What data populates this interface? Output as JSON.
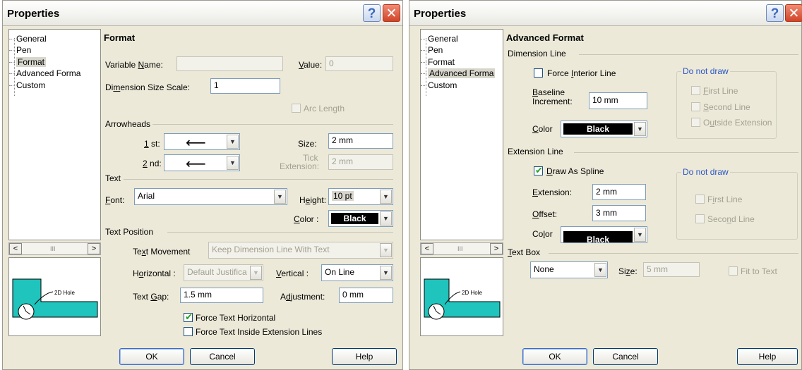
{
  "left": {
    "title": "Properties",
    "tree": [
      "General",
      "Pen",
      "Format",
      "Advanced Forma",
      "Custom"
    ],
    "tree_selected": 2,
    "preview_label": "2D Hole",
    "section_title": "Format",
    "variable_name_label": "Variable Name:",
    "variable_name_value": "",
    "value_label": "Value:",
    "value_value": "0",
    "dim_scale_label": "Dimension Size Scale:",
    "dim_scale_value": "1",
    "arc_length_label": "Arc Length",
    "arrowheads_label": "Arrowheads",
    "first_label": "1st:",
    "second_label": "2nd:",
    "arrow_glyph": "⟵",
    "size_label": "Size:",
    "size_value": "2 mm",
    "tick_ext_label_1": "Tick",
    "tick_ext_label_2": "Extension:",
    "tick_ext_value": "2 mm",
    "text_label": "Text",
    "font_label": "Font:",
    "font_value": "Arial",
    "height_label": "Height:",
    "height_value": "10 pt",
    "color_label": "Color :",
    "color_value": "Black",
    "text_position_label": "Text Position",
    "text_movement_label": "Text Movement",
    "text_movement_value": "Keep Dimension Line With Text",
    "horizontal_label": "Horizontal :",
    "horizontal_value": "Default Justifica",
    "vertical_label": "Vertical :",
    "vertical_value": "On Line",
    "text_gap_label": "Text Gap:",
    "text_gap_value": "1.5 mm",
    "adjustment_label": "Adjustment:",
    "adjustment_value": "0 mm",
    "force_horizontal_label": "Force Text Horizontal",
    "force_horizontal_checked": true,
    "force_inside_label": "Force Text Inside Extension Lines",
    "force_inside_checked": false,
    "ok": "OK",
    "cancel": "Cancel",
    "help": "Help"
  },
  "right": {
    "title": "Properties",
    "tree": [
      "General",
      "Pen",
      "Format",
      "Advanced Forma",
      "Custom"
    ],
    "tree_selected": 3,
    "preview_label": "2D Hole",
    "section_title": "Advanced Format",
    "dimension_line_label": "Dimension Line",
    "force_interior_label": "Force Interior Line",
    "baseline_label_1": "Baseline",
    "baseline_label_2": "Increment:",
    "baseline_value": "10 mm",
    "color_label": "Color",
    "dim_color_value": "Black",
    "do_not_draw_1": "Do not draw",
    "first_line_label": "First Line",
    "second_line_label": "Second Line",
    "outside_extension_label": "Outside Extension",
    "extension_line_label": "Extension Line",
    "draw_as_spline_label": "Draw As Spline",
    "draw_as_spline_checked": true,
    "extension_label": "Extension:",
    "extension_value": "2 mm",
    "offset_label": "Offset:",
    "offset_value": "3 mm",
    "ext_color_value": "Black",
    "do_not_draw_2": "Do not draw",
    "first_line_label_2": "First Line",
    "second_line_label_2": "Second Line",
    "text_box_label": "Text Box",
    "text_box_value": "None",
    "size_label": "Size:",
    "size_value": "5 mm",
    "fit_to_text_label": "Fit to Text",
    "ok": "OK",
    "cancel": "Cancel",
    "help": "Help"
  },
  "colors": {
    "preview_fill": "#1fc4bc",
    "accent_blue": "#2a55c7"
  }
}
